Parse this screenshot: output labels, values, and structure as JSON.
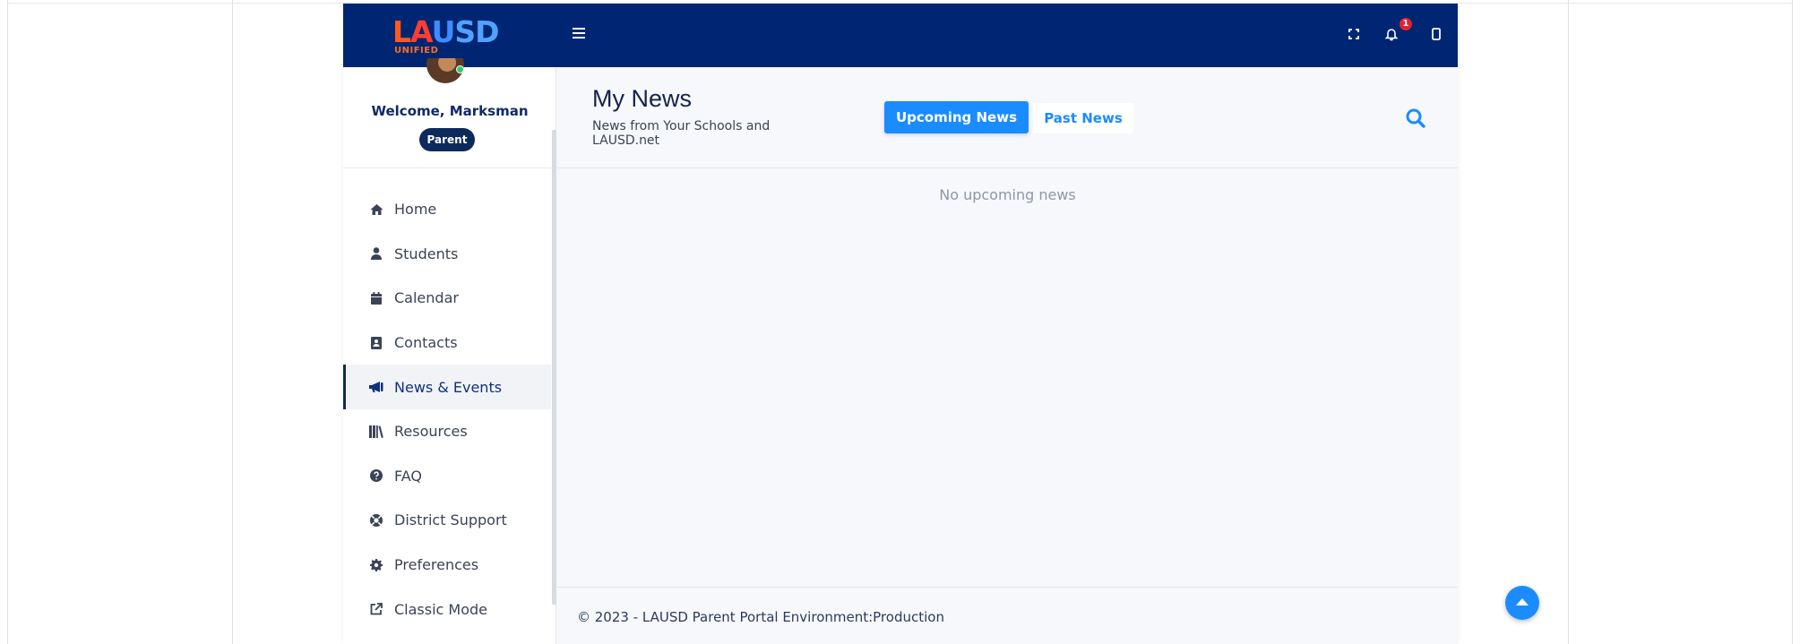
{
  "brand": {
    "logo_letters": [
      "L",
      "A",
      "U",
      "SD"
    ],
    "logo_sub": "UNIFIED",
    "colors": {
      "navy": "#002673",
      "blue": "#1a8cff",
      "orange": "#ff5a1f",
      "red": "#e5202e"
    }
  },
  "topbar": {
    "notification_count": "1",
    "icons": [
      "menu-icon",
      "fullscreen-icon",
      "bell-icon",
      "device-icon"
    ]
  },
  "user": {
    "welcome": "Welcome, Marksman",
    "role": "Parent"
  },
  "sidebar": {
    "items": [
      {
        "label": "Home",
        "icon": "home-icon"
      },
      {
        "label": "Students",
        "icon": "user-icon"
      },
      {
        "label": "Calendar",
        "icon": "calendar-icon"
      },
      {
        "label": "Contacts",
        "icon": "contact-card-icon"
      },
      {
        "label": "News & Events",
        "icon": "megaphone-icon",
        "active": true
      },
      {
        "label": "Resources",
        "icon": "books-icon"
      },
      {
        "label": "FAQ",
        "icon": "question-icon"
      },
      {
        "label": "District Support",
        "icon": "lifebuoy-icon"
      },
      {
        "label": "Preferences",
        "icon": "gear-icon"
      },
      {
        "label": "Classic Mode",
        "icon": "external-link-icon"
      }
    ]
  },
  "main": {
    "title": "My News",
    "subtitle": "News from Your Schools and LAUSD.net",
    "tabs": {
      "upcoming": "Upcoming News",
      "past": "Past News"
    },
    "empty_message": "No upcoming news"
  },
  "footer": {
    "text": "© 2023 - LAUSD Parent Portal Environment:Production"
  }
}
